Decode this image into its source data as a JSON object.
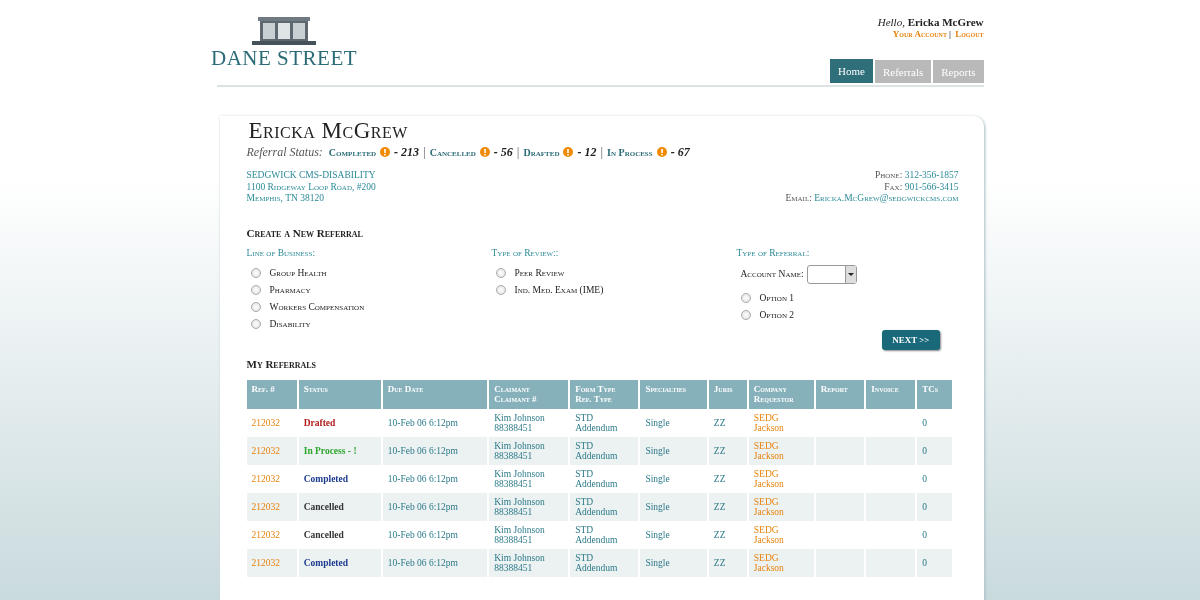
{
  "logo": {
    "text": "DANE STREET"
  },
  "user": {
    "greeting": "Hello,",
    "name": "Ericka McGrew",
    "links": [
      "Your Account",
      "Logout"
    ],
    "separator": "|"
  },
  "tabs": [
    {
      "label": "Home",
      "selected": true
    },
    {
      "label": "Referrals",
      "selected": false
    },
    {
      "label": "Reports",
      "selected": false
    }
  ],
  "profile": {
    "name": "Ericka McGrew",
    "status_label": "Referral Status:",
    "status_separator": "|",
    "statuses": [
      {
        "label": "Completed",
        "count": "- 213"
      },
      {
        "label": "Cancelled",
        "count": "- 56"
      },
      {
        "label": "Drafted",
        "count": "- 12"
      },
      {
        "label": "In Process",
        "count": "- 67"
      }
    ],
    "address": [
      "SEDGWICK CMS-DISABILITY",
      "1100 Ridgeway Loop Road, #200",
      "Memphis, TN 38120"
    ],
    "contacts": [
      {
        "label": "Phone:",
        "value": "312-356-1857"
      },
      {
        "label": "Fax:",
        "value": "901-566-3415"
      },
      {
        "label": "Email:",
        "value": "Ericka.McGrew@sedgwickcms.com"
      }
    ]
  },
  "new_referral": {
    "title": "Create a New Referral",
    "line_of_business": {
      "label": "Line of Business:",
      "options": [
        {
          "label": "Group Health",
          "selected": false
        },
        {
          "label": "Pharmacy",
          "selected": false
        },
        {
          "label": "Workers Compensation",
          "selected": false
        },
        {
          "label": "Disability",
          "selected": false
        }
      ]
    },
    "type_of_review": {
      "label": "Type of Review::",
      "options": [
        {
          "label": "Peer Review",
          "selected": false
        },
        {
          "label": "Ind. Med. Exam (IME)",
          "selected": false
        }
      ]
    },
    "type_of_referral": {
      "label": "Type of Referral:",
      "account_label": "Account Name:",
      "options": [
        {
          "label": "Option 1",
          "selected": false
        },
        {
          "label": "Option 2",
          "selected": false
        }
      ]
    },
    "next_button": "NEXT >>"
  },
  "my_referrals": {
    "title": "My Referrals",
    "columns": [
      [
        "Ref. #"
      ],
      [
        "Status"
      ],
      [
        "Due Date"
      ],
      [
        "Claimant",
        "Claimant #"
      ],
      [
        "Form Type",
        "Ref. Type"
      ],
      [
        "Specialties"
      ],
      [
        "Juris"
      ],
      [
        "Company",
        "Requestor"
      ],
      [
        "Report"
      ],
      [
        "Invoice"
      ],
      [
        "TCs"
      ]
    ],
    "rows": [
      {
        "ref": "212032",
        "status": "Drafted",
        "kind": "drafted",
        "due": "10-Feb 06 6:12pm",
        "claimant": [
          "Kim Johnson",
          "88388451"
        ],
        "form": [
          "STD",
          "Addendum"
        ],
        "specialty": "Single",
        "juris": "ZZ",
        "company": [
          "SEDG",
          "Jackson"
        ],
        "tcs": "0"
      },
      {
        "ref": "212032",
        "status": "In Process - !",
        "kind": "in_process",
        "due": "10-Feb 06 6:12pm",
        "claimant": [
          "Kim Johnson",
          "88388451"
        ],
        "form": [
          "STD",
          "Addendum"
        ],
        "specialty": "Single",
        "juris": "ZZ",
        "company": [
          "SEDG",
          "Jackson"
        ],
        "tcs": "0"
      },
      {
        "ref": "212032",
        "status": "Completed",
        "kind": "completed",
        "due": "10-Feb 06 6:12pm",
        "claimant": [
          "Kim Johnson",
          "88388451"
        ],
        "form": [
          "STD",
          "Addendum"
        ],
        "specialty": "Single",
        "juris": "ZZ",
        "company": [
          "SEDG",
          "Jackson"
        ],
        "tcs": "0"
      },
      {
        "ref": "212032",
        "status": "Cancelled",
        "kind": "cancelled",
        "due": "10-Feb 06 6:12pm",
        "claimant": [
          "Kim Johnson",
          "88388451"
        ],
        "form": [
          "STD",
          "Addendum"
        ],
        "specialty": "Single",
        "juris": "ZZ",
        "company": [
          "SEDG",
          "Jackson"
        ],
        "tcs": "0"
      },
      {
        "ref": "212032",
        "status": "Cancelled",
        "kind": "cancelled",
        "due": "10-Feb 06 6:12pm",
        "claimant": [
          "Kim Johnson",
          "88388451"
        ],
        "form": [
          "STD",
          "Addendum"
        ],
        "specialty": "Single",
        "juris": "ZZ",
        "company": [
          "SEDG",
          "Jackson"
        ],
        "tcs": "0"
      },
      {
        "ref": "212032",
        "status": "Completed",
        "kind": "completed",
        "due": "10-Feb 06 6:12pm",
        "claimant": [
          "Kim Johnson",
          "88388451"
        ],
        "form": [
          "STD",
          "Addendum"
        ],
        "specialty": "Single",
        "juris": "ZZ",
        "company": [
          "SEDG",
          "Jackson"
        ],
        "tcs": "0"
      }
    ]
  }
}
